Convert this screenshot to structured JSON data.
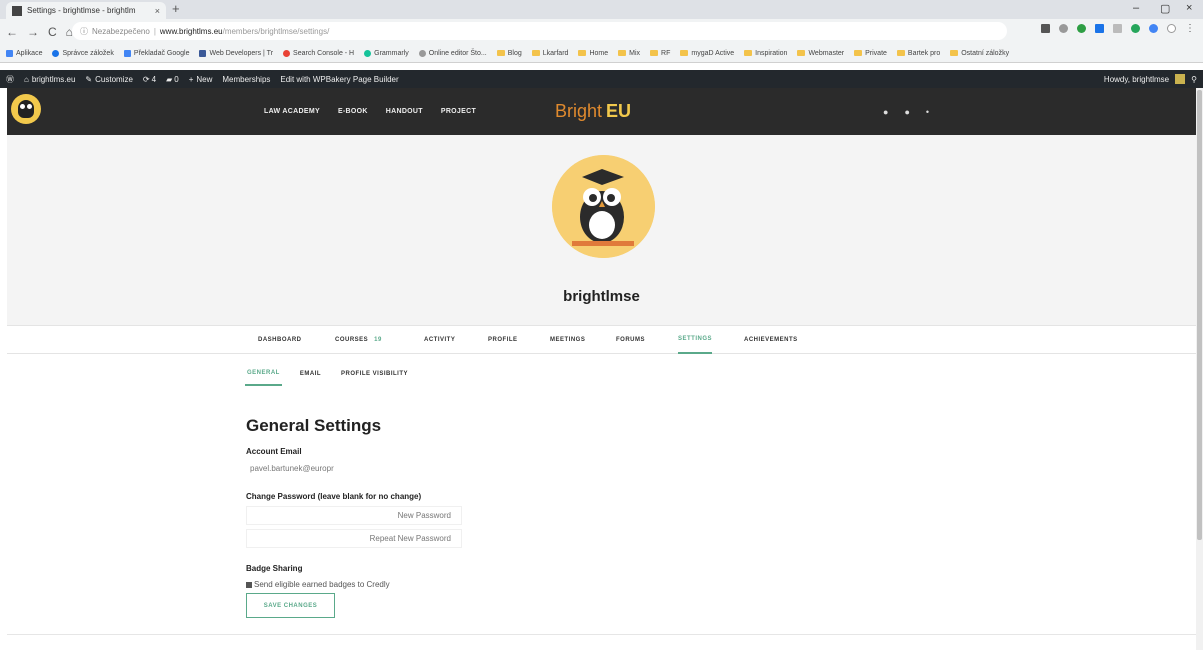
{
  "browser": {
    "tab_title": "Settings - brightlmse - brightlm",
    "tab_close": "×",
    "new_tab": "+",
    "window_controls": [
      "–",
      "▢",
      "×"
    ],
    "nav": [
      "←",
      "→",
      "C",
      "⌂"
    ],
    "address": {
      "secure_label": "Nezabezpečeno",
      "host": "www.brightlms.eu",
      "path": "/members/brightlmse/settings/"
    },
    "bookmarks": [
      "Aplikace",
      "Správce záložek",
      "Překladač Google",
      "Web Developers | Tr",
      "Search Console - H",
      "Grammarly",
      "Online editor Što...",
      "Blog",
      "Lkarfard",
      "Home",
      "Mix",
      "RF",
      "mygaD Active",
      "Inspiration",
      "Webmaster",
      "Private",
      "Bartek pro",
      "Ostatní záložky"
    ]
  },
  "adminbar": {
    "site": "brightlms.eu",
    "customize": "Customize",
    "updates": "4",
    "comments": "0",
    "new": "New",
    "memberships": "Memberships",
    "builder": "Edit with WPBakery Page Builder",
    "howdy": "Howdy, brightlmse"
  },
  "header": {
    "nav": [
      "LAW ACADEMY",
      "E-BOOK",
      "HANDOUT",
      "PROJECT"
    ],
    "brand_part1": "Bright",
    "brand_part2": "EU"
  },
  "profile": {
    "username": "brightlmse",
    "tabs": [
      {
        "label": "DASHBOARD"
      },
      {
        "label": "COURSES",
        "count": "19"
      },
      {
        "label": "ACTIVITY"
      },
      {
        "label": "PROFILE"
      },
      {
        "label": "MEETINGS"
      },
      {
        "label": "FORUMS"
      },
      {
        "label": "SETTINGS",
        "active": true
      },
      {
        "label": "ACHIEVEMENTS"
      }
    ],
    "subtabs": [
      {
        "label": "GENERAL",
        "active": true
      },
      {
        "label": "EMAIL"
      },
      {
        "label": "PROFILE VISIBILITY"
      }
    ]
  },
  "form": {
    "title": "General Settings",
    "email_label": "Account Email",
    "email_value": "pavel.bartunek@europr",
    "password_label": "Change Password (leave blank for no change)",
    "new_password_placeholder": "New Password",
    "repeat_password_placeholder": "Repeat New Password",
    "badge_label": "Badge Sharing",
    "badge_checkbox_label": "Send eligible earned badges to Credly",
    "badge_checked": true,
    "save_label": "SAVE CHANGES"
  },
  "colors": {
    "accent": "#5aa98a",
    "header_bg": "#2b2b2b",
    "adminbar_bg": "#23282d",
    "avatar_bg": "#f7cf72"
  }
}
